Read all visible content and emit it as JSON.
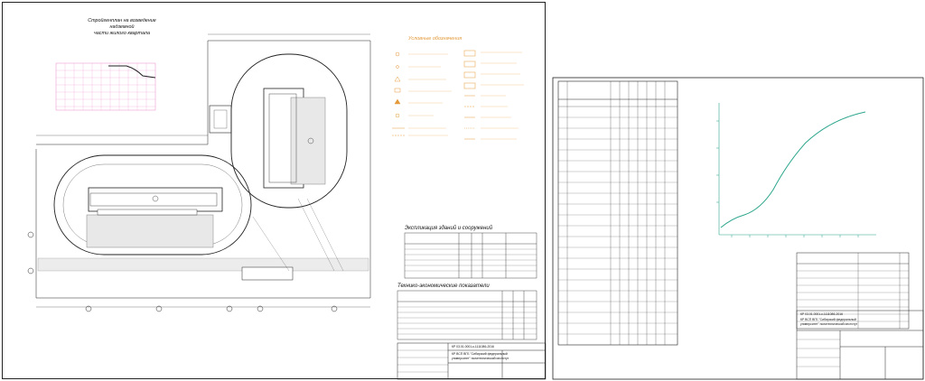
{
  "sheet1": {
    "title_lines": [
      "Стройгенплан на возведение",
      "надземной",
      "части жилого квартала"
    ],
    "legend_title": "Условные обозначения",
    "explication_title": "Экспликация зданий и сооружений",
    "tep_title": "Технико-экономические показатели",
    "stamp_code": "КР 03.01.0001-к-1111086-2016",
    "stamp_line2": "КР ВСП ВГБ \"Сибирский федеральный",
    "stamp_line3": "университет\" политехнический институт"
  },
  "sheet2": {
    "stamp_code": "КР 03.01.0001-к-1111086-2016",
    "stamp_line2": "КР ВСП ВГБ \"Сибирский федеральный",
    "stamp_line3": "университет\" политехнический институт"
  },
  "colors": {
    "legend": "#e39a3a",
    "curve": "#2ca58d",
    "grid": "#e36fbf",
    "line": "#222222"
  }
}
